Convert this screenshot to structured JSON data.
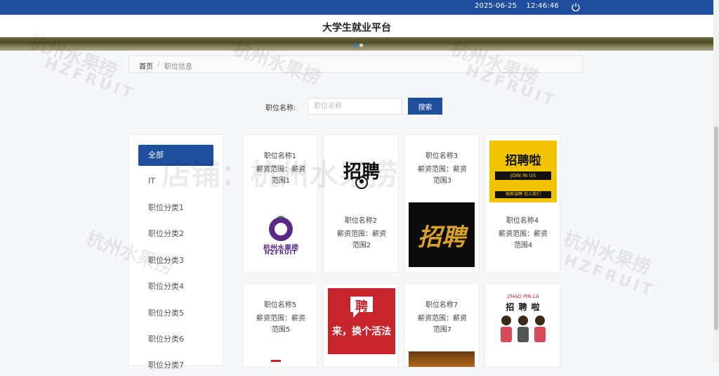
{
  "topbar": {
    "date": "2025-06-25",
    "time": "12:46:46",
    "power_icon": "power-icon"
  },
  "header": {
    "title": "大学生就业平台"
  },
  "breadcrumb": {
    "home": "首页",
    "sep": "/",
    "current": "职位信息"
  },
  "search": {
    "label": "职位名称:",
    "placeholder": "职位名称",
    "button": "搜索"
  },
  "categories": [
    "全部",
    "IT",
    "职位分类1",
    "职位分类2",
    "职位分类3",
    "职位分类4",
    "职位分类5",
    "职位分类6",
    "职位分类7"
  ],
  "jobs": [
    {
      "name": "职位名称1",
      "salary": "薪资范围：薪资范围1",
      "image_text": "杭州水果捞",
      "image_sub": "HZFRUIT"
    },
    {
      "name": "职位名称2",
      "salary": "薪资范围：薪资范围2",
      "image_text": "招聘"
    },
    {
      "name": "职位名称3",
      "salary": "薪资范围：薪资范围3",
      "image_text": "招聘"
    },
    {
      "name": "职位名称4",
      "salary": "薪资范围：薪资范围4",
      "image_text": "招聘啦",
      "image_sub": "JOIN IN US",
      "image_sub2": "高薪诚聘 加入我们"
    },
    {
      "name": "职位名称5",
      "salary": "薪资范围：薪资范围5"
    },
    {
      "name": "",
      "salary": "",
      "image_text": "聘",
      "image_sub": "来，换个活法"
    },
    {
      "name": "职位名称7",
      "salary": "薪资范围：薪资范围7"
    },
    {
      "name": "",
      "salary": "",
      "image_text": "招 聘 啦",
      "image_sub": "ZHAO PIN LA"
    }
  ],
  "watermark": {
    "text1": "店铺：杭州水果捞",
    "text2": "杭州水果捞",
    "text3": "HZFRUIT"
  },
  "colors": {
    "primary": "#1f4e9e",
    "accent_red": "#c8242b",
    "accent_yellow": "#f2c400",
    "purple": "#5b2a86"
  }
}
